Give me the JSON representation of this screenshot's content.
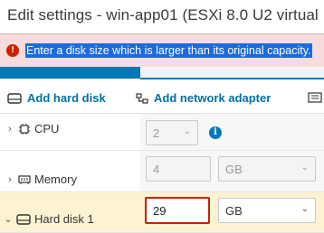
{
  "window": {
    "title": "Edit settings - win-app01 (ESXi 8.0 U2 virtual"
  },
  "alert": {
    "icon": "error-icon",
    "message": "Enter a disk size which is larger than its original capacity.",
    "color": "#c92100"
  },
  "toolbar": {
    "add_hard_disk": "Add hard disk",
    "add_network_adapter": "Add network adapter"
  },
  "rows": {
    "cpu": {
      "label": "CPU",
      "value": "2"
    },
    "memory": {
      "label": "Memory",
      "value": "4",
      "unit": "GB"
    },
    "hard_disk": {
      "label": "Hard disk 1",
      "value": "29",
      "unit": "GB"
    }
  },
  "colors": {
    "accent": "#0079b8",
    "link": "#0072a3",
    "error_bg": "#f6dcdc",
    "selected_row": "#fdf3d3"
  }
}
